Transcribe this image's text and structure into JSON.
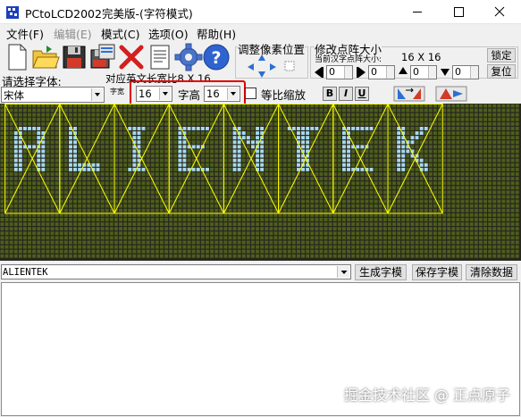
{
  "window": {
    "title": "PCtoLCD2002完美版-(字符模式)",
    "controls": {
      "minimize": "minimize",
      "maximize": "maximize",
      "close": "close"
    }
  },
  "menu": [
    {
      "label": "文件(F)",
      "enabled": true
    },
    {
      "label": "编辑(E)",
      "enabled": false
    },
    {
      "label": "模式(C)",
      "enabled": true
    },
    {
      "label": "选项(O)",
      "enabled": true
    },
    {
      "label": "帮助(H)",
      "enabled": true
    }
  ],
  "toolbar": {
    "icons": [
      "new-file-icon",
      "open-folder-icon",
      "save-disk-icon",
      "save-as-icon",
      "delete-x-icon",
      "document-icon",
      "gear-icon",
      "help-icon"
    ]
  },
  "font_panel": {
    "select_label": "请选择字体:",
    "font_value": "宋体",
    "width_label": "字宽",
    "width_value": "16",
    "height_label": "字高",
    "height_value": "16",
    "en_label": "对应英文长宽比8 X 16",
    "proportional_label": "等比缩放",
    "bold": "B",
    "italic": "I",
    "underline": "U"
  },
  "adjust_panel": {
    "title": "调整像素位置"
  },
  "matrix_panel": {
    "title": "修改点阵大小",
    "current_label": "当前汉字点阵大小:",
    "current_value": "16 X 16",
    "lock_button": "锁定",
    "restore_button": "复位",
    "spinner_values": [
      "0",
      "0",
      "0",
      "0",
      "0"
    ]
  },
  "preview": {
    "text": "ALIENTEK",
    "colors": {
      "background": "#27271e",
      "off_pixel": "#4e5e1c",
      "on_pixel": "#a8d9ef",
      "guide": "#ffff00"
    }
  },
  "actions": {
    "generate": "生成字模",
    "save": "保存字模",
    "clear": "清除数据"
  },
  "watermark": "掘金技术社区 @ 正点原子"
}
